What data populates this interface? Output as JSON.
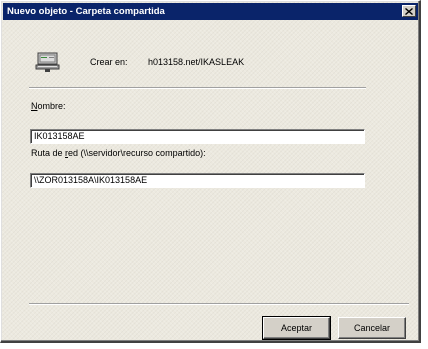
{
  "window": {
    "title": "Nuevo objeto - Carpeta compartida"
  },
  "header": {
    "icon": "network-share-icon",
    "crear_label": "Crear en:",
    "crear_value": "h013158.net/IKASLEAK"
  },
  "form": {
    "nombre_label_accel": "N",
    "nombre_label_rest": "ombre:",
    "nombre_value": "IK013158AE",
    "ruta_label_pre": "Ruta de ",
    "ruta_label_accel": "r",
    "ruta_label_rest": "ed (\\\\servidor\\recurso compartido):",
    "ruta_value": "\\\\ZOR013158A\\IK013158AE"
  },
  "buttons": {
    "accept": "Aceptar",
    "cancel": "Cancelar"
  },
  "colors": {
    "titlebar": "#0a246a",
    "dialog_bg": "#ece9df"
  }
}
